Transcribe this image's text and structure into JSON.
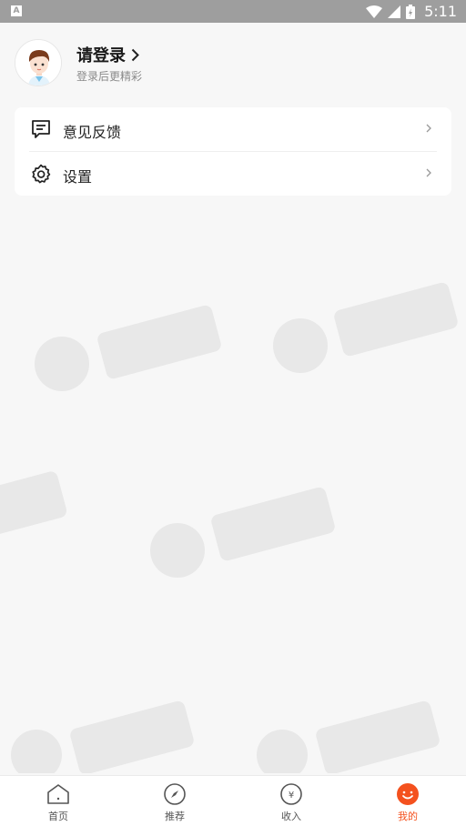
{
  "status_bar": {
    "time": "5:11",
    "left_icon": "A"
  },
  "profile": {
    "title": "请登录",
    "subtitle": "登录后更精彩"
  },
  "menu": [
    {
      "label": "意见反馈",
      "icon": "feedback-icon"
    },
    {
      "label": "设置",
      "icon": "settings-icon"
    }
  ],
  "tabs": [
    {
      "label": "首页",
      "icon": "home-icon",
      "active": false
    },
    {
      "label": "推荐",
      "icon": "compass-icon",
      "active": false
    },
    {
      "label": "收入",
      "icon": "yuan-coin-icon",
      "active": false
    },
    {
      "label": "我的",
      "icon": "smile-face-icon",
      "active": true
    }
  ],
  "colors": {
    "accent": "#f4511e",
    "statusbar": "#9e9e9e",
    "background": "#f7f7f7"
  }
}
